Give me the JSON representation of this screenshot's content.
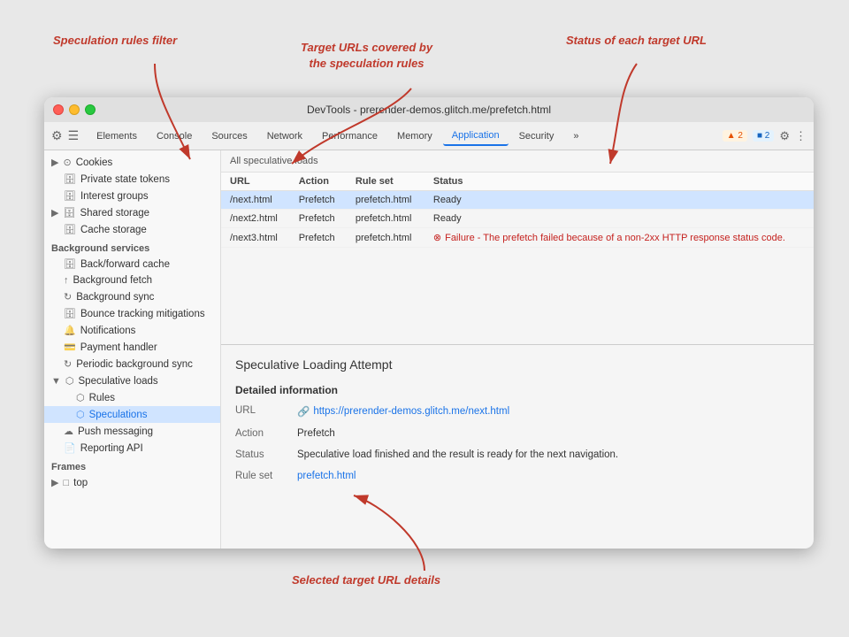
{
  "annotations": {
    "label1": "Speculation rules filter",
    "label2": "Target URLs covered by\nthe speculation rules",
    "label3": "Status of each target URL",
    "label4": "Selected target URL details"
  },
  "browser": {
    "title": "DevTools - prerender-demos.glitch.me/prefetch.html",
    "controls": {
      "close": "close",
      "minimize": "minimize",
      "maximize": "maximize"
    }
  },
  "toolbar": {
    "tabs": [
      {
        "label": "Elements",
        "active": false
      },
      {
        "label": "Console",
        "active": false
      },
      {
        "label": "Sources",
        "active": false
      },
      {
        "label": "Network",
        "active": false
      },
      {
        "label": "Performance",
        "active": false
      },
      {
        "label": "Memory",
        "active": false
      },
      {
        "label": "Application",
        "active": true
      },
      {
        "label": "Security",
        "active": false
      },
      {
        "label": "»",
        "active": false
      }
    ],
    "badge_warn": "▲ 2",
    "badge_info": "■ 2",
    "gear_icon": "⚙",
    "more_icon": "⋮"
  },
  "sidebar": {
    "cookies_label": "Cookies",
    "private_state_tokens_label": "Private state tokens",
    "interest_groups_label": "Interest groups",
    "shared_storage_label": "Shared storage",
    "cache_storage_label": "Cache storage",
    "bg_services_label": "Background services",
    "back_forward_cache_label": "Back/forward cache",
    "background_fetch_label": "Background fetch",
    "background_sync_label": "Background sync",
    "bounce_tracking_label": "Bounce tracking mitigations",
    "notifications_label": "Notifications",
    "payment_handler_label": "Payment handler",
    "periodic_bg_sync_label": "Periodic background sync",
    "speculative_loads_label": "Speculative loads",
    "rules_label": "Rules",
    "speculations_label": "Speculations",
    "push_messaging_label": "Push messaging",
    "reporting_api_label": "Reporting API",
    "frames_label": "Frames",
    "top_label": "top"
  },
  "table": {
    "all_loads_label": "All speculative loads",
    "columns": [
      "URL",
      "Action",
      "Rule set",
      "Status"
    ],
    "rows": [
      {
        "url": "/next.html",
        "action": "Prefetch",
        "rule_set": "prefetch.html",
        "status": "Ready",
        "status_type": "ready"
      },
      {
        "url": "/next2.html",
        "action": "Prefetch",
        "rule_set": "prefetch.html",
        "status": "Ready",
        "status_type": "ready"
      },
      {
        "url": "/next3.html",
        "action": "Prefetch",
        "rule_set": "prefetch.html",
        "status": "Failure - The prefetch failed because of a non-2xx HTTP response status code.",
        "status_type": "error"
      }
    ]
  },
  "detail": {
    "title": "Speculative Loading Attempt",
    "section_title": "Detailed information",
    "url_label": "URL",
    "url_value": "https://prerender-demos.glitch.me/next.html",
    "action_label": "Action",
    "action_value": "Prefetch",
    "status_label": "Status",
    "status_value": "Speculative load finished and the result is ready for the next navigation.",
    "rule_set_label": "Rule set",
    "rule_set_value": "prefetch.html"
  }
}
